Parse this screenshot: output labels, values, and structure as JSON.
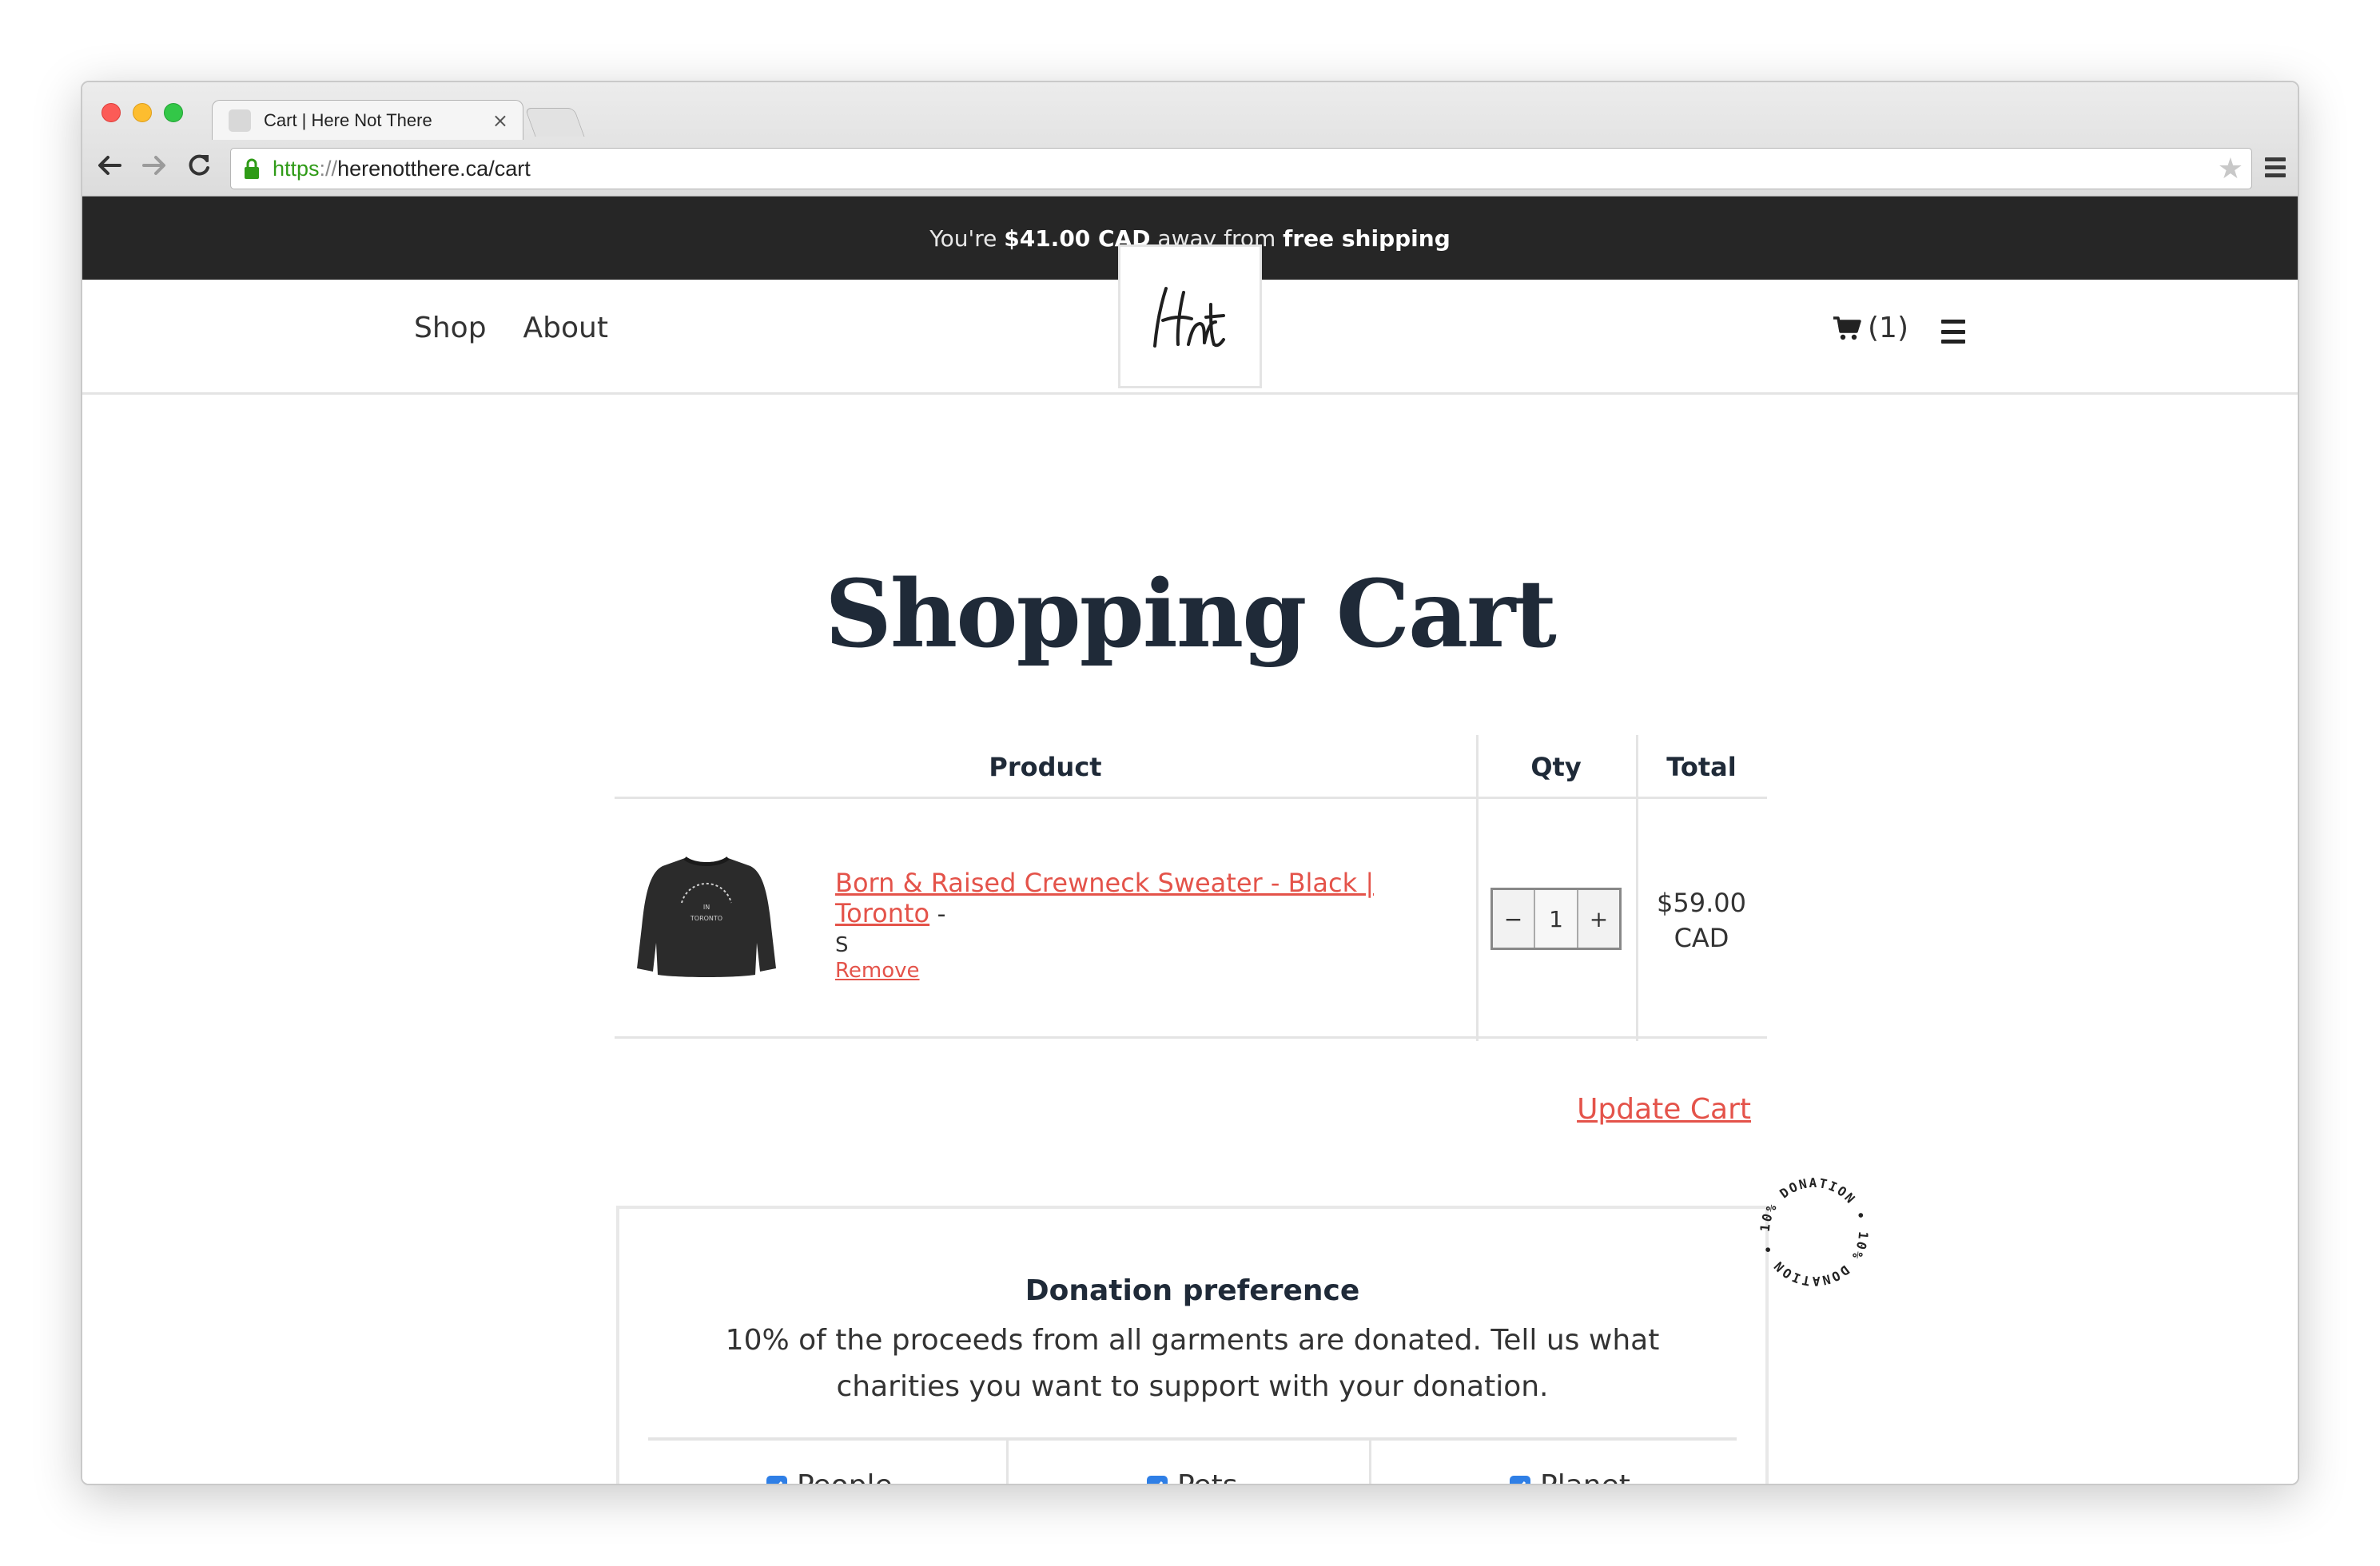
{
  "browser": {
    "tab_title": "Cart | Here Not There",
    "tab_close": "×",
    "url_scheme": "https",
    "url_sep": "://",
    "url_rest": "herenotthere.ca/cart",
    "star": "★"
  },
  "announcement": {
    "prefix": "You're ",
    "amount": "$41.00 CAD",
    "middle": " away from ",
    "goal": "free shipping"
  },
  "header": {
    "nav": [
      "Shop",
      "About"
    ],
    "cart_count": "(1)",
    "logo_text": "Hnt"
  },
  "page_title": "Shopping Cart",
  "cart": {
    "columns": {
      "product": "Product",
      "qty": "Qty",
      "total": "Total"
    },
    "items": [
      {
        "title": "Born & Raised Crewneck Sweater - Black | Toronto",
        "dash": " -",
        "variant": "S",
        "remove_label": "Remove",
        "qty": "1",
        "qty_minus": "−",
        "qty_plus": "+",
        "total_amount": "$59.00",
        "total_currency": "CAD",
        "print_text": "BORN & RAISED · IN · TORONTO"
      }
    ],
    "update_label": "Update Cart"
  },
  "donation": {
    "title": "Donation preference",
    "text": "10% of the proceeds from all garments are donated. Tell us what charities you want to support with your donation.",
    "options": [
      {
        "label": "People",
        "checked": true
      },
      {
        "label": "Pets",
        "checked": true
      },
      {
        "label": "Planet",
        "checked": true
      }
    ],
    "badge_text": "10% DONATION • 10% DONATION •"
  },
  "colors": {
    "accent": "#e4534a",
    "heading": "#1f2a38",
    "announcement_bg": "#262626",
    "checkbox": "#2f7fe6"
  }
}
